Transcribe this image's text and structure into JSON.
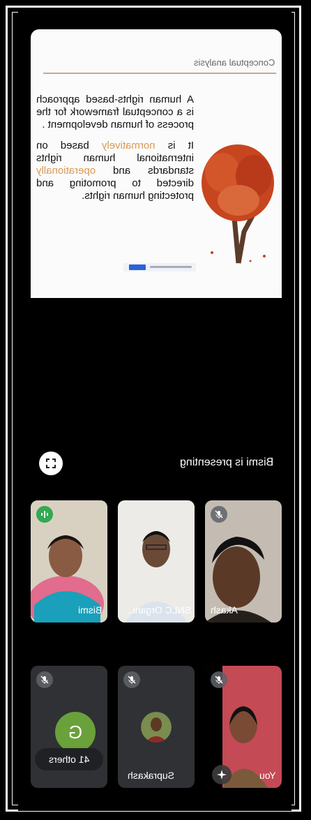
{
  "slide": {
    "title": "Conceptual analysis",
    "para1": "A human rights-based approach is a conceptual framework for the process of human development .",
    "para2_a": "It is ",
    "para2_hl1": "normatively",
    "para2_b": " based on international human rights standards and ",
    "para2_hl2": "operationally",
    "para2_c": " directed to promoting and protecting human rights."
  },
  "presenting_label": "Bismi is presenting",
  "participants": [
    {
      "name": "Bismi",
      "muted": false,
      "speaking": true
    },
    {
      "name": "SNLC Organi...",
      "muted": false,
      "speaking": false
    },
    {
      "name": "Akash",
      "muted": true,
      "speaking": false
    },
    {
      "name": "G",
      "avatar_letter": "G",
      "muted": true
    },
    {
      "name": "Suprakash",
      "muted": true
    },
    {
      "name": "You",
      "muted": true
    }
  ],
  "others_label": "41 others",
  "colors": {
    "speaking": "#34a853",
    "avatar_g": "#6aa13a",
    "highlight": "#d89a55"
  },
  "icons": [
    "fullscreen-icon",
    "mic-off-icon",
    "audio-level-icon",
    "sparkle-icon"
  ]
}
